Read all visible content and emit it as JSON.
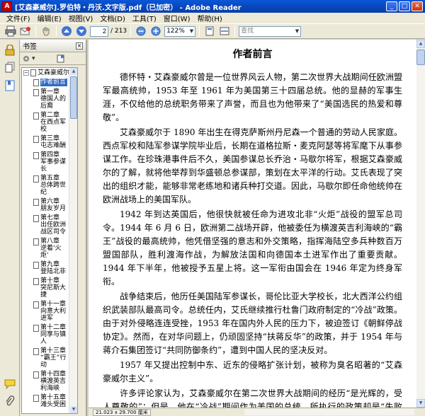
{
  "window": {
    "title": "[艾森豪威尔].罗伯特・丹沃.文字版.pdf（已加密） - Adobe Reader",
    "icon_glyph": "A",
    "buttons": [
      "_",
      "□",
      "✕"
    ]
  },
  "menu": {
    "items": [
      "文件(F)",
      "编辑(E)",
      "视图(V)",
      "文档(D)",
      "工具(T)",
      "窗口(W)",
      "帮助(H)"
    ]
  },
  "toolbar": {
    "current_page": "2",
    "total_pages": "/ 213",
    "zoom": "122%",
    "search_placeholder": "查找"
  },
  "bookmarks": {
    "header": "书签",
    "close_glyph": "×",
    "options_glyph": "▾",
    "root_expander": "−",
    "root_label": "艾森豪威尔",
    "items": [
      "作者前言",
      "第一章 德国人的后裔",
      "第二章 在西点军校",
      "第三章 屯志难酬",
      "第四章 军事参谋长",
      "第五章 总体跨世纪",
      "第六章 朋友岁月",
      "第七章 出任欧洲战区司令",
      "第八章 逆着'火炬'",
      "第九章 登陆北非",
      "第十章 突尼斯大捷",
      "第十一章 向意大利进军",
      "第十二章 同享与镇人",
      "第十三章 “霸王”行动",
      "第十四章 横渡英吉利海峡",
      "第十五章 滩头受困"
    ]
  },
  "document": {
    "title": "作者前言",
    "paragraphs": [
      "德怀特・艾森豪威尔曾是一位世界风云人物，第二次世界大战期间任欧洲盟军最高统帅，1953 年至 1961 年为美国第三十四届总统。他的显赫的军事生涯，不仅给他的总统职务带来了声誉，而且也为他带来了“美国选民的热爱和尊敬”。",
      "艾森豪威尔于 1890 年出生在得克萨斯州丹尼森一个普通的劳动人民家庭。西点军校和陆军参谋学院毕业后，长期在道格拉斯・麦克阿瑟等将军麾下从事参谋工作。在珍珠港事件后不久，美国参谋总长乔治・马歇尔将军，根据艾森豪威尔的了解，就将他举荐到华盛顿总参谋部，策划在太平洋的行动。艾氏表现了突出的组织才能，能够非常老练地和诸兵种打交道。因此，马歇尔即任命他统帅在欧洲战场上的美国军队。",
      "1942 年到达英国后，他很快就被任命为进攻北非“火炬”战役的盟军总司令。1944 年 6 月 6 日，欧洲第二战场开辟，他被委任为横渡英吉利海峡的“霸王”战役的最高统帅，他凭借坚强的意志和外交策略，指挥海陆空多兵种数百万盟国部队，胜利渡海作战，为解放法国和向德国本土进军作出了重要贡献。1944 年下半年，他被授予五星上将。这一军衔由国会在 1946 年定为终身军衔。",
      "战争结束后，他历任美国陆军参谋长，哥伦比亚大学校长，北大西洋公约组织武装部队最高司令。总统任内，艾氏继续推行杜鲁门政府制定的“冷战”政策。由于对外侵略连连受挫，1953 年在国内外人民的压力下，被迫签订《朝鲜停战协定》。然而，在对华问题上，仍顽固坚持“扶蒋反华”的政策，并于 1954 年与蒋介石集团签订“共同防御条约”，遭到中国人民的坚决反对。",
      "1957 年又提出控制中东、近东的侵略扩张计划，被称为臭名昭著的“艾森豪威尔主义”。",
      "许多评论家认为，艾森豪威尔在第二次世界大战期间的经历“是光辉的，受人尊敬的”；但是，他在“冷战”期间作为美国的总统，所执行的政策却是“失败的，令人咒诅的”。"
    ]
  },
  "statusbar": {
    "page_size": "21.023 x 29.700 厘米"
  },
  "colors": {
    "titlebar": "#0845b8",
    "selection": "#316ac5",
    "chrome": "#ece9d8",
    "pdf_red": "#c00000"
  }
}
